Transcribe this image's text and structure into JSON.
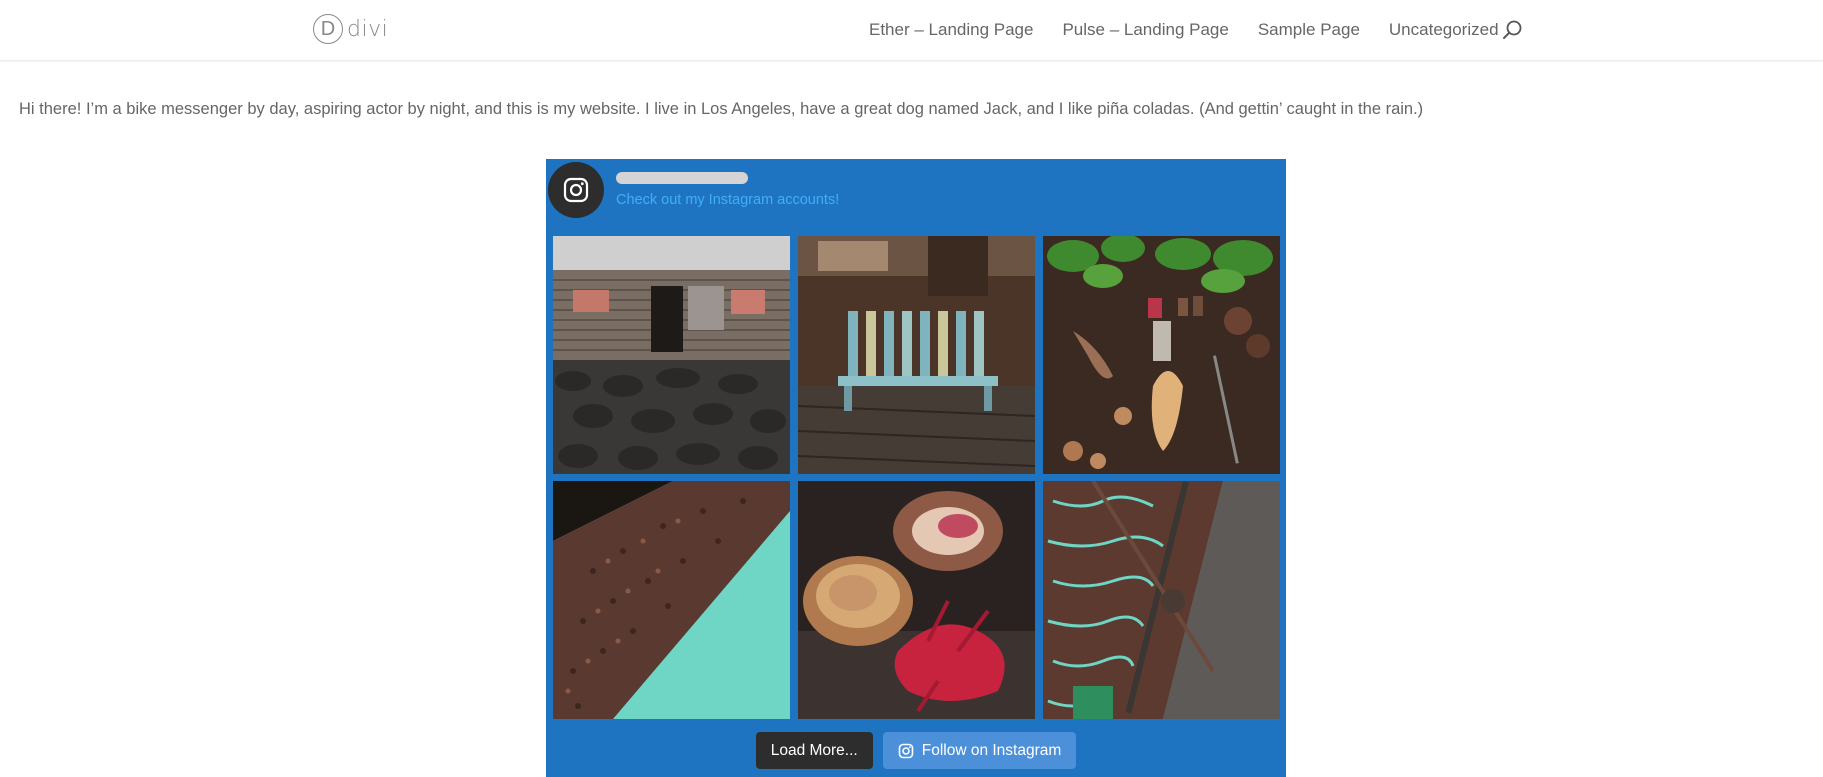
{
  "header": {
    "logo_mark": "D",
    "logo_text": "divi",
    "nav": [
      "Ether – Landing Page",
      "Pulse – Landing Page",
      "Sample Page",
      "Uncategorized"
    ]
  },
  "intro": "Hi there! I’m a bike messenger by day, aspiring actor by night, and this is my website. I live in Los Angeles, have a great dog named Jack, and I like piña coladas. (And gettin’ caught in the rain.)",
  "instagram": {
    "username": "",
    "bio": "Check out my Instagram accounts!",
    "load_more": "Load More...",
    "follow": "Follow on Instagram",
    "photos": [
      "wooden-shed-on-stone-wall",
      "blue-wooden-bench",
      "spices-on-wooden-table",
      "cloves-on-turquoise",
      "nutmeg-and-mace",
      "drying-tray-with-tool"
    ]
  },
  "colors": {
    "accent": "#1f74c2",
    "bio_link": "#40aef7",
    "follow_button": "#4b90d9",
    "load_button": "#2d2d2d"
  }
}
